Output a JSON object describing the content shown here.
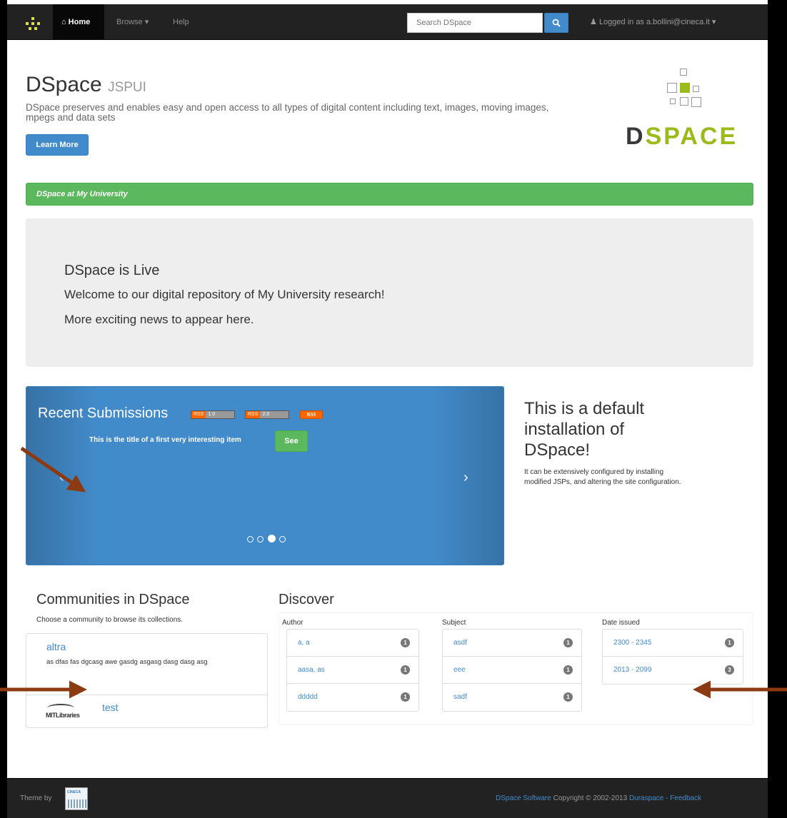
{
  "navbar": {
    "home_label": "Home",
    "browse_label": "Browse",
    "help_label": "Help",
    "search_placeholder": "Search DSpace",
    "user_label": "Logged in as a.bollini@cineca.it"
  },
  "jumbotron": {
    "title": "DSpace",
    "title_small": "JSPUI",
    "text": "DSpace preserves and enables easy and open access to all types of digital content including text, images, moving images, mpegs and data sets",
    "learn_more": "Learn More",
    "logo_prefix": "D",
    "logo_accent": "SPACE"
  },
  "banner": {
    "text": "DSpace at My University"
  },
  "news": {
    "heading": "DSpace is Live",
    "line1": "Welcome to our digital repository of My University research!",
    "line2": "More exciting news to appear here."
  },
  "carousel": {
    "title": "Recent Submissions",
    "rss1": "RSS 1.0",
    "rss1_left": "RSS",
    "rss1_right": "1.0",
    "rss2_left": "RSS",
    "rss2_right": "2.0",
    "rss3": "RSS",
    "item_title": "This is the title of a first very interesting item",
    "see_label": "See",
    "prev": "‹",
    "next": "›",
    "slide_count": 4,
    "active_slide": 3
  },
  "side": {
    "heading": "This is a default installation of DSpace!",
    "text": "It can be extensively configured by installing modified JSPs, and altering the site configuration."
  },
  "communities": {
    "heading": "Communities in DSpace",
    "subtitle": "Choose a community to browse its collections.",
    "items": [
      {
        "name": "altra",
        "description": "as dfas fas dgcasg awe gasdg asgasg dasg dasg asg"
      },
      {
        "name": "test",
        "logo_text": "MITLibraries"
      }
    ]
  },
  "discover": {
    "heading": "Discover",
    "facets": [
      {
        "label": "Author",
        "values": [
          {
            "name": "a, a",
            "count": "1"
          },
          {
            "name": "aasa, as",
            "count": "1"
          },
          {
            "name": "ddddd",
            "count": "1"
          }
        ]
      },
      {
        "label": "Subject",
        "values": [
          {
            "name": "asdf",
            "count": "1"
          },
          {
            "name": "eee",
            "count": "1"
          },
          {
            "name": "sadf",
            "count": "1"
          }
        ]
      },
      {
        "label": "Date issued",
        "values": [
          {
            "name": "2300 - 2345",
            "count": "1"
          },
          {
            "name": "2013 - 2099",
            "count": "3"
          }
        ]
      }
    ]
  },
  "footer": {
    "theme_by": "Theme by",
    "cineca_text": "CINECA",
    "software_link": "DSpace Software",
    "copyright": " Copyright © 2002-2013 ",
    "duraspace_link": "Duraspace",
    "separator": " - ",
    "feedback_link": "Feedback"
  },
  "colors": {
    "primary": "#428bca",
    "success": "#5cb85c",
    "navbar_bg": "#222222",
    "arrow": "#8b3a12",
    "logo_green": "#9bbb1a"
  },
  "icons": [
    "dspace-brand-icon",
    "home-icon",
    "caret-down-icon",
    "search-icon",
    "user-icon",
    "rss-icon",
    "annotation-arrow-icon"
  ]
}
